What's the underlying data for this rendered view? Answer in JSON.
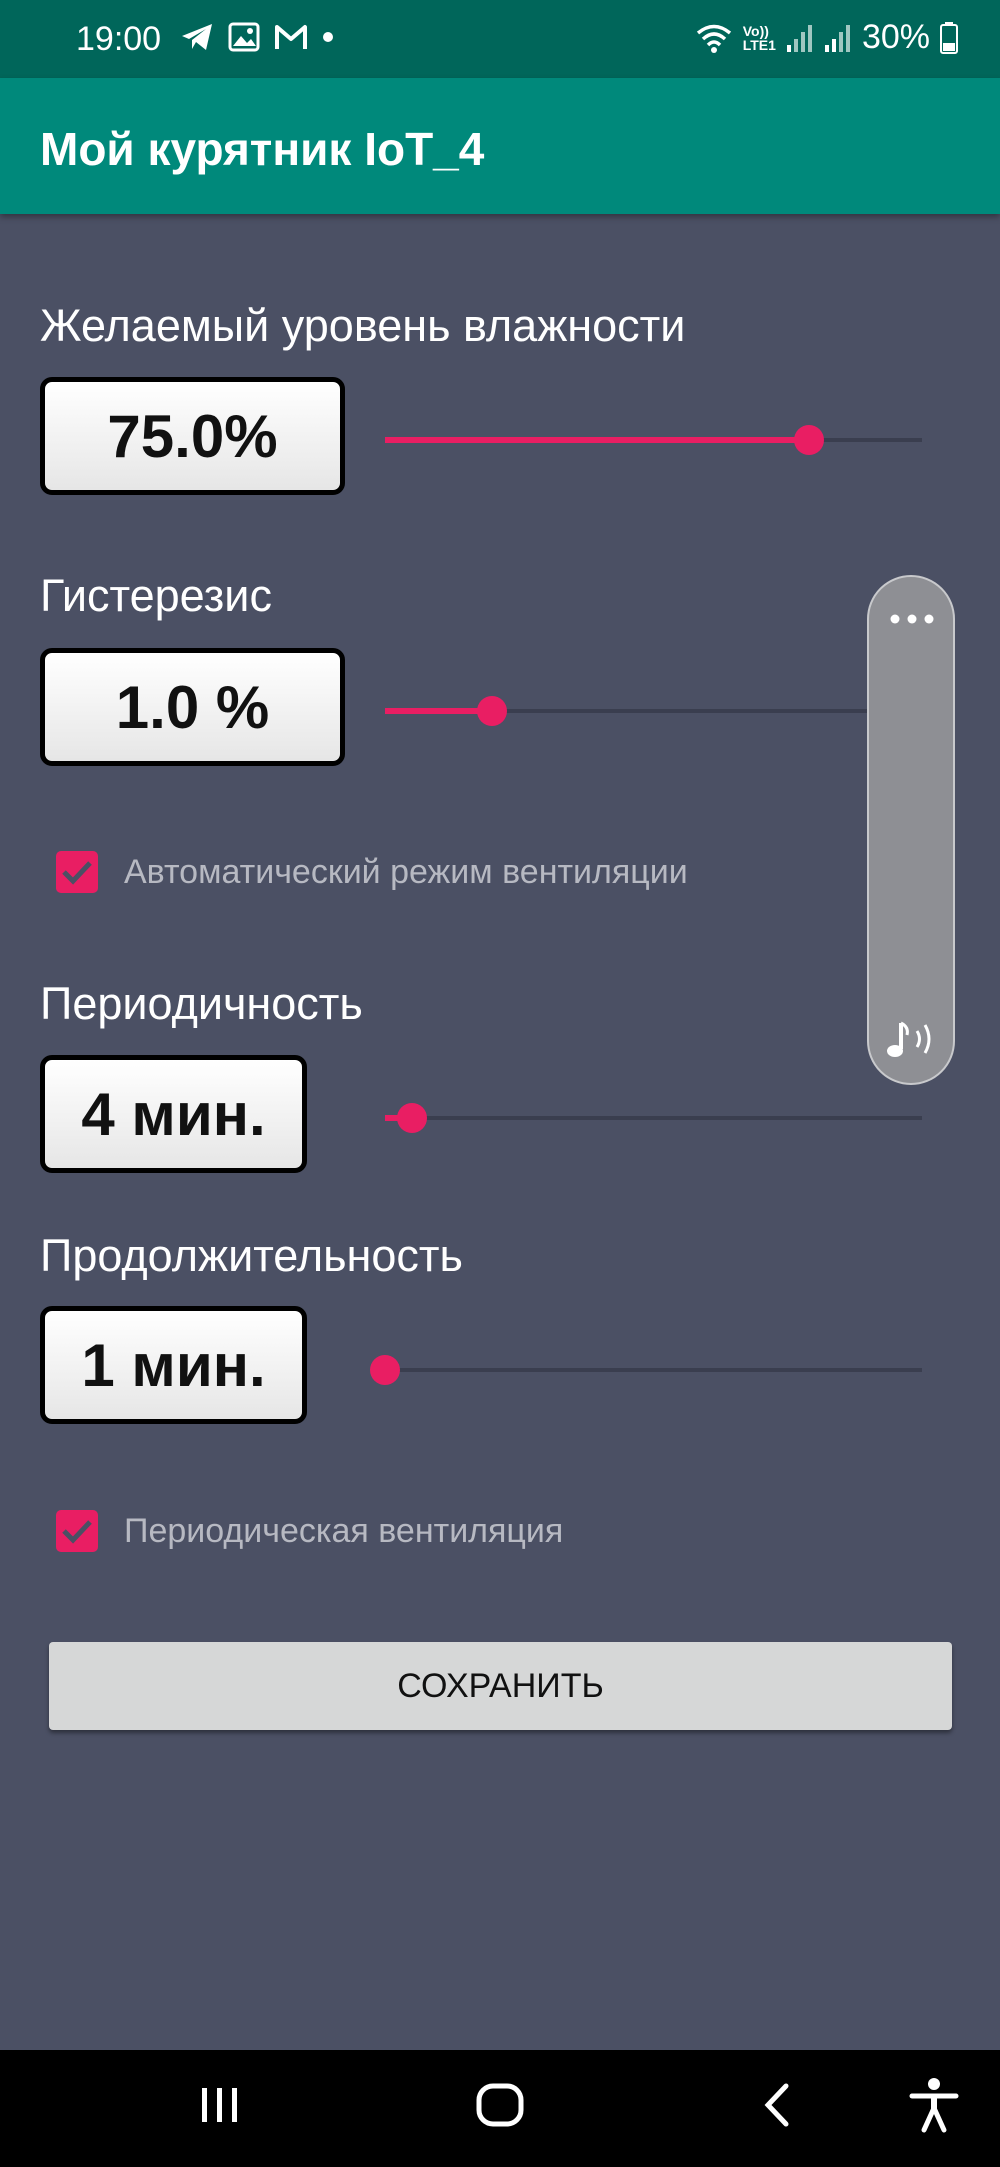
{
  "status": {
    "time": "19:00",
    "battery": "30%",
    "network_label_top": "Vo))",
    "network_label_bottom": "LTE1",
    "notification_icons": [
      "telegram-icon",
      "gallery-icon",
      "gmail-icon",
      "dot-icon"
    ]
  },
  "app": {
    "title": "Мой курятник IoT_4"
  },
  "humidity": {
    "label": "Желаемый уровень влажности",
    "value": "75.0%",
    "slider_fraction": 0.79
  },
  "hysteresis": {
    "label": "Гистерезис",
    "value": "1.0 %",
    "slider_fraction": 0.2
  },
  "auto_vent": {
    "label": "Автоматический режим вентиляции",
    "checked": true
  },
  "period": {
    "label": "Периодичность",
    "value": "4 мин.",
    "slider_fraction": 0.05
  },
  "duration": {
    "label": "Продолжительность",
    "value": "1 мин.",
    "slider_fraction": 0.0
  },
  "periodic_vent": {
    "label": "Периодическая вентиляция",
    "checked": true
  },
  "save": {
    "label": "СОХРАНИТЬ"
  },
  "colors": {
    "accent": "#e91e63",
    "app_bar": "#00897b",
    "status_bar": "#00665a",
    "background": "#4b5064"
  }
}
